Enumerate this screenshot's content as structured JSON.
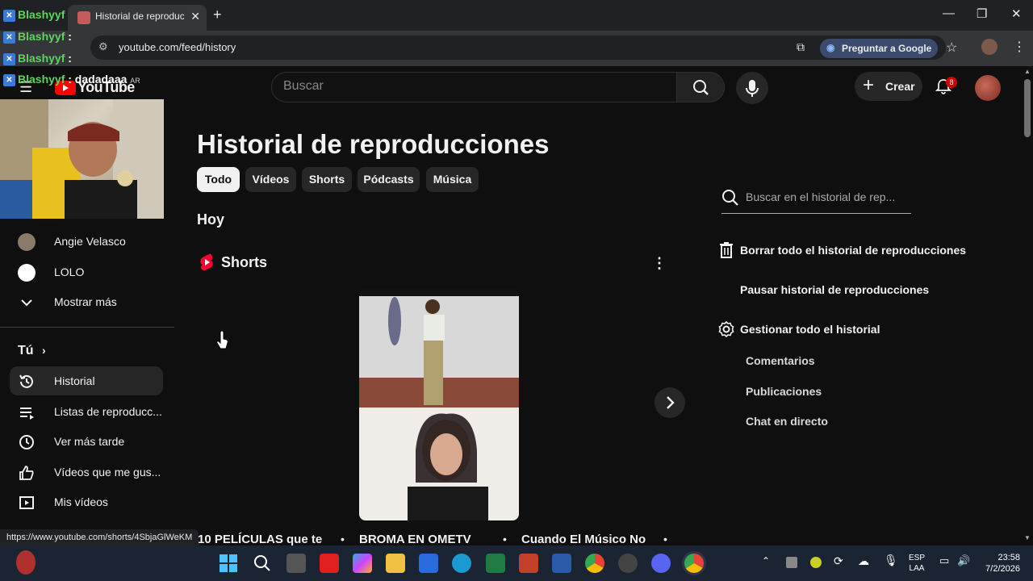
{
  "browser": {
    "tab_title": "Historial de reproducciones",
    "url": "youtube.com/feed/history",
    "ask_google": "Preguntar a Google"
  },
  "chat": [
    {
      "user": "Blashyyf",
      "msg": ""
    },
    {
      "user": "Blashyyf",
      "msg": " :"
    },
    {
      "user": "Blashyyf",
      "msg": " :"
    },
    {
      "user": "Blashyyf",
      "msg": " : dadadaaa",
      "suffix": "AR"
    }
  ],
  "header": {
    "logo_text": "YouTube",
    "search_placeholder": "Buscar",
    "create_label": "Crear",
    "notification_count": "8"
  },
  "sidebar": {
    "subscriptions": [
      {
        "label": "Angie Velasco"
      },
      {
        "label": "LOLO"
      },
      {
        "label": "Mostrar más"
      }
    ],
    "you_section": "Tú",
    "items": [
      {
        "label": "Historial",
        "icon": "history-icon"
      },
      {
        "label": "Listas de reproducc...",
        "icon": "playlist-icon"
      },
      {
        "label": "Ver más tarde",
        "icon": "clock-icon"
      },
      {
        "label": "Vídeos que me gus...",
        "icon": "thumbs-up-icon"
      },
      {
        "label": "Mis vídeos",
        "icon": "my-videos-icon"
      }
    ]
  },
  "main": {
    "title": "Historial de reproducciones",
    "chips": [
      "Todo",
      "Vídeos",
      "Shorts",
      "Pódcasts",
      "Música"
    ],
    "day": "Hoy",
    "shorts_heading": "Shorts",
    "short_titles": [
      "10 PELÍCULAS que te",
      "BROMA EN OMETV",
      "Cuando El Músico No"
    ]
  },
  "right_panel": {
    "search_placeholder": "Buscar en el historial de rep...",
    "clear_all": "Borrar todo el historial de reproducciones",
    "pause": "Pausar historial de reproducciones",
    "manage": "Gestionar todo el historial",
    "links": [
      "Comentarios",
      "Publicaciones",
      "Chat en directo"
    ]
  },
  "status_url": "https://www.youtube.com/shorts/4SbjaGlWeKM",
  "taskbar": {
    "lang": "ESP",
    "lang_sub": "LAA",
    "time": "23:58",
    "date": "7/2/2026"
  },
  "colors": {
    "background": "#0f0f0f",
    "accent_red": "#ff0000",
    "chip_active": "#f1f1f1"
  }
}
